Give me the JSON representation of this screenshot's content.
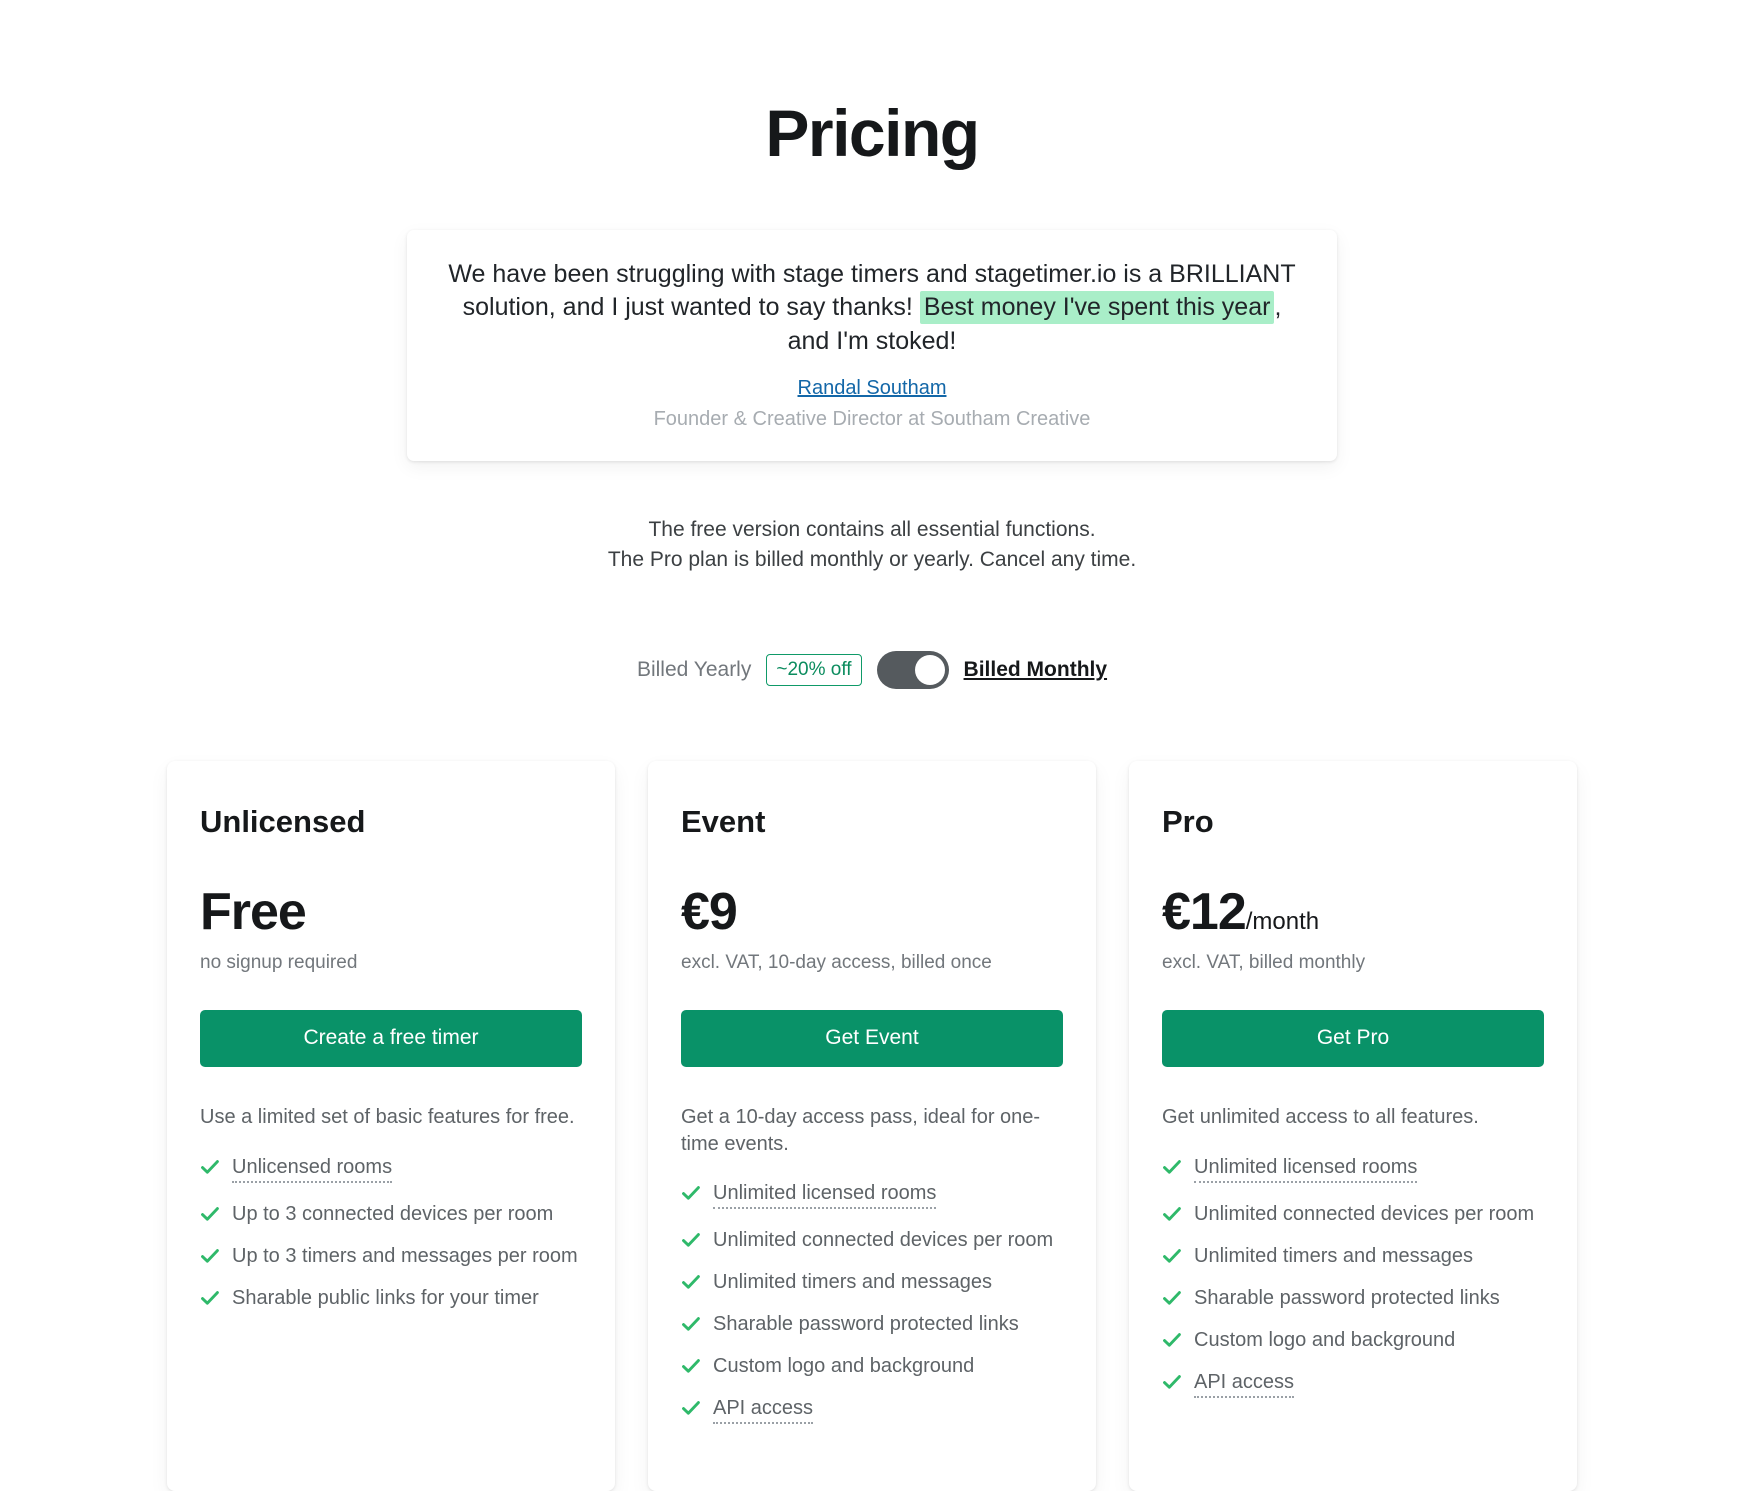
{
  "page": {
    "title": "Pricing"
  },
  "testimonial": {
    "quote_part1": "We have been struggling with stage timers and stagetimer.io is a BRILLIANT solution, and I just wanted to say thanks! ",
    "quote_highlight": "Best money I've spent this year",
    "quote_part2": ", and I'm stoked!",
    "author": "Randal Southam",
    "role": "Founder & Creative Director at Southam Creative",
    "highlight_color": "#a9eec8",
    "author_link_color": "#1367a8"
  },
  "intro": {
    "line1": "The free version contains all essential functions.",
    "line2": "The Pro plan is billed monthly or yearly. Cancel any time."
  },
  "billing": {
    "yearly_label": "Billed Yearly",
    "discount_badge": "~20% off",
    "monthly_label": "Billed Monthly",
    "toggle_state": "monthly",
    "accent_color": "#0f9a68"
  },
  "plans": [
    {
      "name": "Unlicensed",
      "price": "Free",
      "period": "",
      "price_note": "no signup required",
      "cta_label": "Create a free timer",
      "description": "Use a limited set of basic features for free.",
      "features": [
        {
          "label": "Unlicensed rooms",
          "dotted": true
        },
        {
          "label": "Up to 3 connected devices per room",
          "dotted": false
        },
        {
          "label": "Up to 3 timers and messages per room",
          "dotted": false
        },
        {
          "label": "Sharable public links for your timer",
          "dotted": false
        }
      ]
    },
    {
      "name": "Event",
      "price": "€9",
      "period": "",
      "price_note": "excl. VAT, 10-day access, billed once",
      "cta_label": "Get Event",
      "description": "Get a 10-day access pass, ideal for one-time events.",
      "features": [
        {
          "label": "Unlimited licensed rooms",
          "dotted": true
        },
        {
          "label": "Unlimited connected devices per room",
          "dotted": false
        },
        {
          "label": "Unlimited timers and messages",
          "dotted": false
        },
        {
          "label": "Sharable password protected links",
          "dotted": false
        },
        {
          "label": "Custom logo and background",
          "dotted": false
        },
        {
          "label": "API access",
          "dotted": true
        }
      ]
    },
    {
      "name": "Pro",
      "price": "€12",
      "period": "/month",
      "price_note": "excl. VAT, billed monthly",
      "cta_label": "Get Pro",
      "description": "Get unlimited access to all features.",
      "features": [
        {
          "label": "Unlimited licensed rooms",
          "dotted": true
        },
        {
          "label": "Unlimited connected devices per room",
          "dotted": false
        },
        {
          "label": "Unlimited timers and messages",
          "dotted": false
        },
        {
          "label": "Sharable password protected links",
          "dotted": false
        },
        {
          "label": "Custom logo and background",
          "dotted": false
        },
        {
          "label": "API access",
          "dotted": true
        }
      ]
    }
  ],
  "colors": {
    "cta_green": "#099268",
    "check_green": "#2fb96a",
    "text_dark": "#16181a",
    "text_muted": "#72777c"
  }
}
